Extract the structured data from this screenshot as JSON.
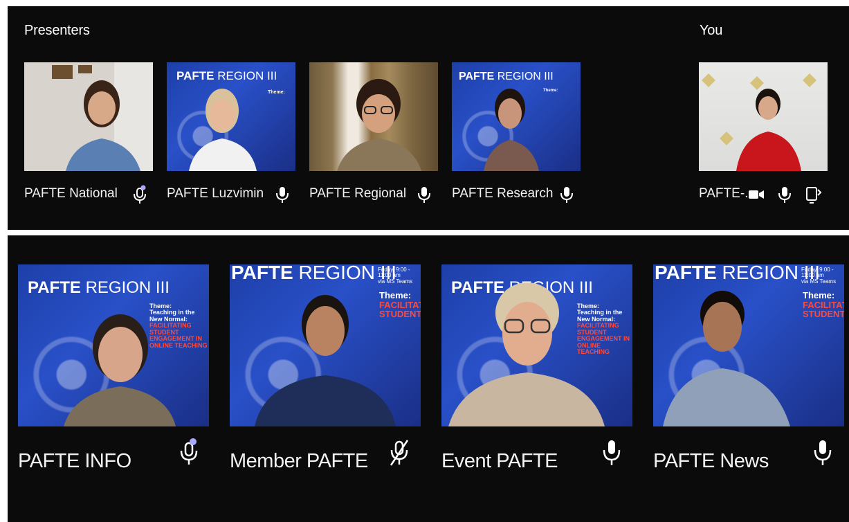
{
  "presenters_heading": "Presenters",
  "you_heading": "You",
  "presenters": [
    {
      "name": "PAFTE National",
      "mic": "mic-active"
    },
    {
      "name": "PAFTE Luzvimin",
      "mic": "mic"
    },
    {
      "name": "PAFTE Regional",
      "mic": "mic"
    },
    {
      "name": "PAFTE Research",
      "mic": "mic"
    }
  ],
  "you": {
    "name": "PAFTE-...",
    "controls": [
      "camera-icon",
      "mic-icon",
      "share-screen-icon"
    ]
  },
  "participants": [
    {
      "name": "PAFTE INFO",
      "mic": "mic-active"
    },
    {
      "name": "Member PAFTE",
      "mic": "mic-muted"
    },
    {
      "name": "Event PAFTE",
      "mic": "mic"
    },
    {
      "name": "PAFTE News",
      "mic": "mic"
    }
  ],
  "background_brand": {
    "bold": "PAFTE",
    "thin": "REGION",
    "numeral": "III",
    "theme_label": "Theme:",
    "theme_lines": [
      "Teaching in the",
      "New Normal:"
    ],
    "theme_red_lines": [
      "FACILITATING",
      "STUDENT",
      "ENGAGEMENT IN",
      "ONLINE TEACHING"
    ],
    "schedule": "Friday, 9:00 - 11:00 am",
    "platform": "via MS Teams"
  },
  "colors": {
    "panel": "#0b0b0b",
    "speaking_dot": "#a8a8ff",
    "brand_blue": "#1d3fa8"
  }
}
